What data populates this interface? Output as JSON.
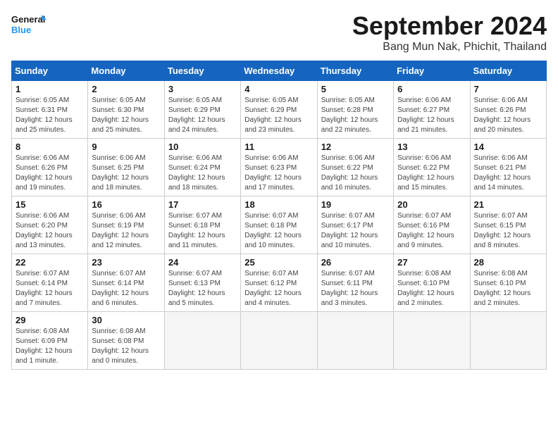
{
  "header": {
    "logo_line1": "General",
    "logo_line2": "Blue",
    "month_title": "September 2024",
    "location": "Bang Mun Nak, Phichit, Thailand"
  },
  "calendar": {
    "days_of_week": [
      "Sunday",
      "Monday",
      "Tuesday",
      "Wednesday",
      "Thursday",
      "Friday",
      "Saturday"
    ],
    "weeks": [
      [
        null,
        {
          "day": "2",
          "sunrise": "6:05 AM",
          "sunset": "6:30 PM",
          "daylight": "12 hours and 25 minutes."
        },
        {
          "day": "3",
          "sunrise": "6:05 AM",
          "sunset": "6:29 PM",
          "daylight": "12 hours and 24 minutes."
        },
        {
          "day": "4",
          "sunrise": "6:05 AM",
          "sunset": "6:29 PM",
          "daylight": "12 hours and 23 minutes."
        },
        {
          "day": "5",
          "sunrise": "6:05 AM",
          "sunset": "6:28 PM",
          "daylight": "12 hours and 22 minutes."
        },
        {
          "day": "6",
          "sunrise": "6:06 AM",
          "sunset": "6:27 PM",
          "daylight": "12 hours and 21 minutes."
        },
        {
          "day": "7",
          "sunrise": "6:06 AM",
          "sunset": "6:26 PM",
          "daylight": "12 hours and 20 minutes."
        }
      ],
      [
        {
          "day": "1",
          "sunrise": "6:05 AM",
          "sunset": "6:31 PM",
          "daylight": "12 hours and 25 minutes."
        },
        {
          "day": "9",
          "sunrise": "6:06 AM",
          "sunset": "6:25 PM",
          "daylight": "12 hours and 18 minutes."
        },
        {
          "day": "10",
          "sunrise": "6:06 AM",
          "sunset": "6:24 PM",
          "daylight": "12 hours and 18 minutes."
        },
        {
          "day": "11",
          "sunrise": "6:06 AM",
          "sunset": "6:23 PM",
          "daylight": "12 hours and 17 minutes."
        },
        {
          "day": "12",
          "sunrise": "6:06 AM",
          "sunset": "6:22 PM",
          "daylight": "12 hours and 16 minutes."
        },
        {
          "day": "13",
          "sunrise": "6:06 AM",
          "sunset": "6:22 PM",
          "daylight": "12 hours and 15 minutes."
        },
        {
          "day": "14",
          "sunrise": "6:06 AM",
          "sunset": "6:21 PM",
          "daylight": "12 hours and 14 minutes."
        }
      ],
      [
        {
          "day": "8",
          "sunrise": "6:06 AM",
          "sunset": "6:26 PM",
          "daylight": "12 hours and 19 minutes."
        },
        {
          "day": "16",
          "sunrise": "6:06 AM",
          "sunset": "6:19 PM",
          "daylight": "12 hours and 12 minutes."
        },
        {
          "day": "17",
          "sunrise": "6:07 AM",
          "sunset": "6:18 PM",
          "daylight": "12 hours and 11 minutes."
        },
        {
          "day": "18",
          "sunrise": "6:07 AM",
          "sunset": "6:18 PM",
          "daylight": "12 hours and 10 minutes."
        },
        {
          "day": "19",
          "sunrise": "6:07 AM",
          "sunset": "6:17 PM",
          "daylight": "12 hours and 10 minutes."
        },
        {
          "day": "20",
          "sunrise": "6:07 AM",
          "sunset": "6:16 PM",
          "daylight": "12 hours and 9 minutes."
        },
        {
          "day": "21",
          "sunrise": "6:07 AM",
          "sunset": "6:15 PM",
          "daylight": "12 hours and 8 minutes."
        }
      ],
      [
        {
          "day": "15",
          "sunrise": "6:06 AM",
          "sunset": "6:20 PM",
          "daylight": "12 hours and 13 minutes."
        },
        {
          "day": "23",
          "sunrise": "6:07 AM",
          "sunset": "6:14 PM",
          "daylight": "12 hours and 6 minutes."
        },
        {
          "day": "24",
          "sunrise": "6:07 AM",
          "sunset": "6:13 PM",
          "daylight": "12 hours and 5 minutes."
        },
        {
          "day": "25",
          "sunrise": "6:07 AM",
          "sunset": "6:12 PM",
          "daylight": "12 hours and 4 minutes."
        },
        {
          "day": "26",
          "sunrise": "6:07 AM",
          "sunset": "6:11 PM",
          "daylight": "12 hours and 3 minutes."
        },
        {
          "day": "27",
          "sunrise": "6:08 AM",
          "sunset": "6:10 PM",
          "daylight": "12 hours and 2 minutes."
        },
        {
          "day": "28",
          "sunrise": "6:08 AM",
          "sunset": "6:10 PM",
          "daylight": "12 hours and 2 minutes."
        }
      ],
      [
        {
          "day": "22",
          "sunrise": "6:07 AM",
          "sunset": "6:14 PM",
          "daylight": "12 hours and 7 minutes."
        },
        {
          "day": "30",
          "sunrise": "6:08 AM",
          "sunset": "6:08 PM",
          "daylight": "12 hours and 0 minutes."
        },
        null,
        null,
        null,
        null,
        null
      ],
      [
        {
          "day": "29",
          "sunrise": "6:08 AM",
          "sunset": "6:09 PM",
          "daylight": "12 hours and 1 minute."
        },
        null,
        null,
        null,
        null,
        null,
        null
      ]
    ]
  }
}
